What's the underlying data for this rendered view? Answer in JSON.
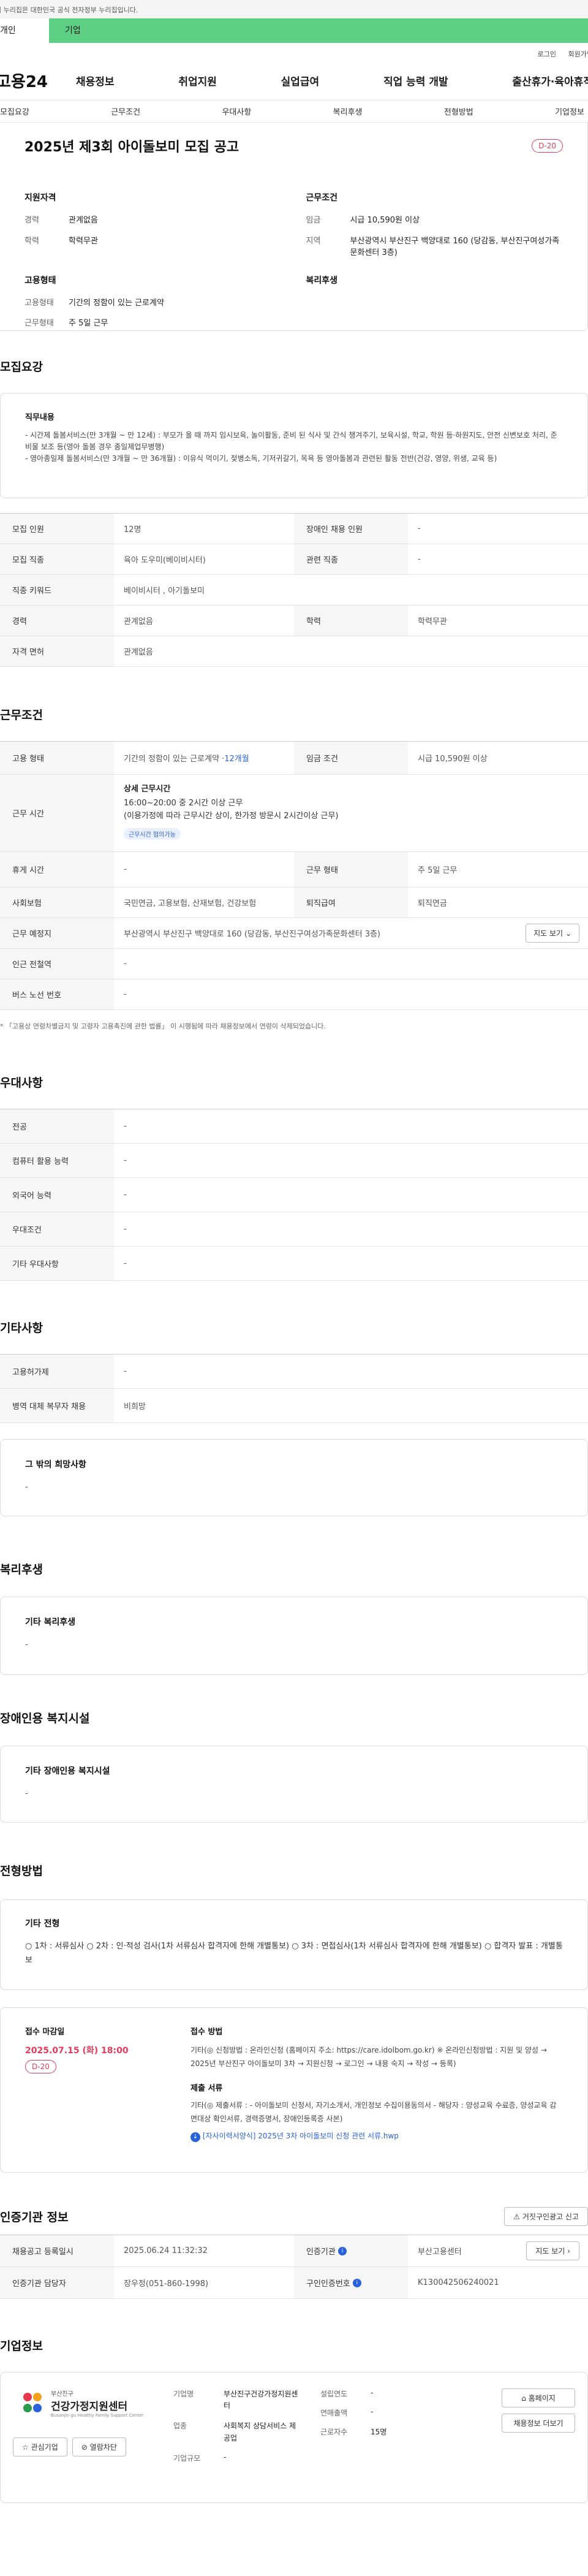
{
  "gov_banner": "이 누리집은 대한민국 공식 전자정부 누리집입니다.",
  "portal_tabs": [
    "개인",
    "기업"
  ],
  "util_links": [
    "로그인",
    "회원가입"
  ],
  "logo": "고용24",
  "gnb": [
    "채용정보",
    "취업지원",
    "실업급여",
    "직업 능력 개발",
    "출산휴가·육아휴직"
  ],
  "snb": [
    "모집요강",
    "근무조건",
    "우대사항",
    "복리후생",
    "전형방법",
    "기업정보"
  ],
  "summary": {
    "title": "2025년 제3회 아이돌보미 모집 공고",
    "dday": "D-20",
    "qual_heading": "지원자격",
    "qual_rows": [
      {
        "k": "경력",
        "v": "관계없음"
      },
      {
        "k": "학력",
        "v": "학력무관"
      }
    ],
    "cond_heading": "근무조건",
    "cond_rows": [
      {
        "k": "임금",
        "v": "시급 10,590원 이상"
      },
      {
        "k": "지역",
        "v": "부산광역시 부산진구 백양대로 160 (당감동, 부산진구여성가족문화센터 3층)"
      }
    ],
    "emp_heading": "고용형태",
    "emp_rows": [
      {
        "k": "고용형태",
        "v": "기간의 정함이 있는 근로계약"
      },
      {
        "k": "근무형태",
        "v": "주 5일 근무"
      }
    ],
    "welfare_heading": "복리후생"
  },
  "recruit": {
    "title": "모집요강",
    "duty_label": "직무내용",
    "duty_lines": [
      "- 시간제 돌봄서비스(만 3개월 ~ 만 12세) : 부모가 올 때 까지 임시보육, 놀이활동, 준비 된 식사 및 간식 챙겨주기, 보육시설, 학교, 학원 등·하원지도, 안전 신변보호 처리, 준비물 보조 등(영아 돌봄 경우 종일제업무병행)",
      "- 영아종일제 돌봄서비스(만 3개월 ~ 만 36개월) : 이유식 먹이기, 젖병소독, 기저귀갈기, 목욕 등 영아돌봄과 관련된 활동 전반(건강, 영양, 위생, 교육 등)"
    ],
    "rows": [
      {
        "k1": "모집 인원",
        "v1": "12명",
        "k2": "장애인 채용 인원",
        "v2": "-"
      },
      {
        "k1": "모집 직종",
        "v1": "육아 도우미(베이비시터)",
        "k2": "관련 직종",
        "v2": "-"
      }
    ],
    "keyword_label": "직종 키워드",
    "keyword_value": "베이비시터 , 아기돌보미",
    "rows2": [
      {
        "k1": "경력",
        "v1": "관계없음",
        "k2": "학력",
        "v2": "학력무관"
      }
    ],
    "license_label": "자격 면허",
    "license_value": "관계없음"
  },
  "work": {
    "title": "근무조건",
    "emp_type_label": "고용 형태",
    "emp_type_value": "기간의 정함이 있는 근로계약 · ",
    "emp_type_months": "12개월",
    "wage_label": "임금 조건",
    "wage_value": "시급 10,590원 이상",
    "hours_label": "근무 시간",
    "hours_title": "상세 근무시간",
    "hours_line1": "16:00~20:00 중 2시간 이상 근무",
    "hours_line2": "(이용가정에 따라 근무시간 상이, 한가정 방문시 2시간이상 근무)",
    "hours_tag": "근무시간 협의가능",
    "rows": [
      {
        "k1": "휴게 시간",
        "v1": "-",
        "k2": "근무 형태",
        "v2": "주 5일 근무"
      },
      {
        "k1": "사회보험",
        "v1": "국민연금, 고용보험, 산재보험, 건강보험",
        "k2": "퇴직급여",
        "v2": "퇴직연금"
      }
    ],
    "place_label": "근무 예정지",
    "place_value": "부산광역시 부산진구 백양대로 160 (당감동, 부산진구여성가족문화센터 3층)",
    "map_btn": "지도 보기",
    "subway_label": "인근 전철역",
    "subway_value": "-",
    "bus_label": "버스 노선 번호",
    "bus_value": "-",
    "note": "* 「고용상 연령차별금지 및 고령자 고용촉진에 관한 법률」 이 시행됨에 따라 채용정보에서 연령이 삭제되었습니다."
  },
  "pref": {
    "title": "우대사항",
    "rows": [
      {
        "k": "전공",
        "v": "-"
      },
      {
        "k": "컴퓨터 활용 능력",
        "v": "-"
      },
      {
        "k": "외국어 능력",
        "v": "-"
      },
      {
        "k": "우대조건",
        "v": "-"
      },
      {
        "k": "기타 우대사항",
        "v": "-"
      }
    ]
  },
  "etc": {
    "title": "기타사항",
    "rows": [
      {
        "k": "고용허가제",
        "v": "-"
      },
      {
        "k": "병역 대체 복무자 채용",
        "v": "비희망"
      }
    ],
    "hope_label": "그 밖의 희망사항",
    "hope_value": "-"
  },
  "welfare": {
    "title": "복리후생",
    "label": "기타 복리후생",
    "value": "-"
  },
  "disability": {
    "title": "장애인용 복지시설",
    "label": "기타 장애인용 복지시설",
    "value": "-"
  },
  "selection": {
    "title": "전형방법",
    "label": "기타 전형",
    "value": "○ 1차 : 서류심사 ○ 2차 : 인·적성 검사(1차 서류심사 합격자에 한해 개별통보) ○ 3차 : 면접심사(1차 서류심사 합격자에 한해 개별통보) ○ 합격자 발표 : 개별통보",
    "deadline_label": "접수 마감일",
    "deadline_value": "2025.07.15 (화) 18:00",
    "deadline_dday": "D-20",
    "method_label": "접수 방법",
    "method_value": "기타(◎ 신청방법 : 온라인신청 (홈페이지 주소: https://care.idolbom.go.kr) ※ 온라인신청방법 : 지원 및 양성 → 2025년 부산진구 아이돌보미 3차 → 지원신청 → 로그인 → 내용 숙지 → 작성 → 등록)",
    "docs_label": "제출 서류",
    "docs_value": "기타(◎ 제출서류 : - 아이돌보미 신청서, 자기소개서, 개인정보 수집이용동의서 - 해당자 : 양성교육 수료증, 양성교육 감면대상 확인서류, 경력증명서, 장애인등록증 사본)",
    "attachment": "[자사이력서양식] 2025년 3차 아이돌보미 신청 관련 서류.hwp"
  },
  "cert": {
    "title": "인증기관 정보",
    "report_btn": "거짓구인광고 신고",
    "row1": {
      "k1": "채용공고 등록일시",
      "v1": "2025.06.24 11:32:32",
      "k2": "인증기관",
      "v2": "부산고용센터",
      "btn": "지도 보기"
    },
    "row2": {
      "k1": "인증기관 담당자",
      "v1": "장우정(051-860-1998)",
      "k2": "구인인증번호",
      "v2": "K130042506240021"
    }
  },
  "company": {
    "title": "기업정보",
    "logo_sub": "부산진구",
    "logo_main": "건강가정지원센터",
    "logo_en": "Busanjin-gu Healthy Family Support Center",
    "fav_btn": "관심기업",
    "block_btn": "열람차단",
    "name_label": "기업명",
    "name_value": "부산진구건강가정지원센터",
    "industry_label": "업종",
    "industry_value": "사회복지 상담서비스 제공업",
    "scale_label": "기업규모",
    "scale_value": "-",
    "founded_label": "설립연도",
    "founded_value": "-",
    "revenue_label": "연매출액",
    "revenue_value": "-",
    "staff_label": "근로자수",
    "staff_value": "15명",
    "home_btn": "홈페이지",
    "jobs_btn": "채용정보 더보기"
  }
}
